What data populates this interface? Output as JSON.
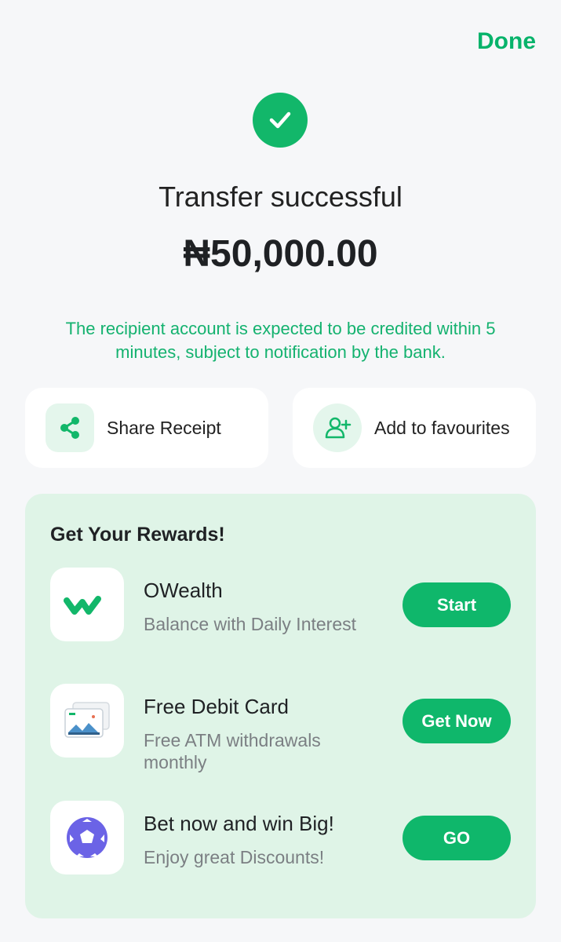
{
  "header": {
    "done_label": "Done"
  },
  "status": {
    "title": "Transfer successful",
    "amount": "₦50,000.00",
    "notice": "The recipient account is expected to be credited within 5 minutes, subject to notification by the bank."
  },
  "actions": {
    "share_label": "Share Receipt",
    "favourites_label": "Add to favourites"
  },
  "rewards": {
    "title": "Get Your Rewards!",
    "items": [
      {
        "name": "OWealth",
        "desc": "Balance with Daily Interest",
        "button": "Start",
        "icon": "owealth-logo-icon"
      },
      {
        "name": "Free Debit Card",
        "desc": "Free ATM withdrawals monthly",
        "button": "Get Now",
        "icon": "debit-card-icon"
      },
      {
        "name": "Bet now and win Big!",
        "desc": "Enjoy great Discounts!",
        "button": "GO",
        "icon": "football-icon"
      }
    ]
  },
  "colors": {
    "accent": "#12b76a",
    "rewards_bg": "#dff4e7",
    "background": "#f6f7f9"
  }
}
